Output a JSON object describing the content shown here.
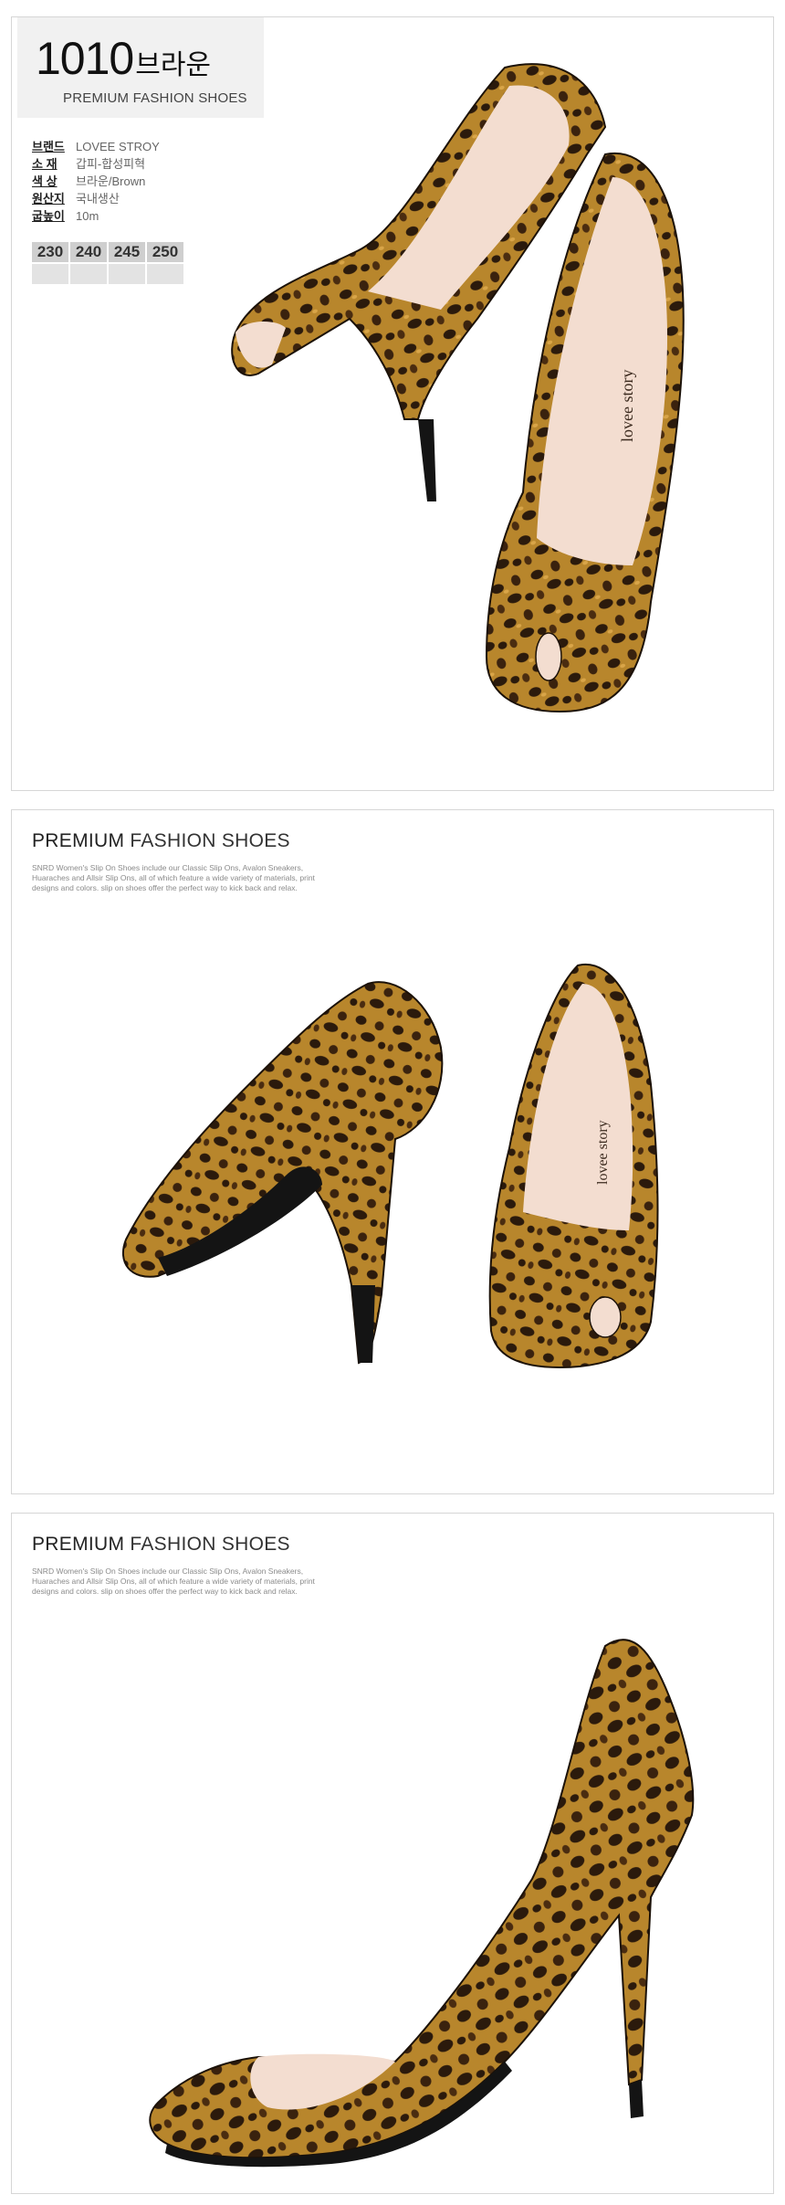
{
  "header": {
    "model_number": "1010",
    "model_color": "브라운",
    "subtitle": "PREMIUM FASHION SHOES"
  },
  "specs": [
    {
      "key": "브랜드",
      "value": "LOVEE STROY"
    },
    {
      "key": "소   재",
      "value": "갑피-합성피혁"
    },
    {
      "key": "색   상",
      "value": "브라운/Brown"
    },
    {
      "key": "원산지",
      "value": "국내생산"
    },
    {
      "key": "굽높이",
      "value": "10m"
    }
  ],
  "sizes": [
    "230",
    "240",
    "245",
    "250"
  ],
  "sections": [
    {
      "title_a": "PREMIUM",
      "title_b": " FASHION SHOES",
      "desc": "SNRD Women's Slip On Shoes include our Classic Slip Ons, Avalon Sneakers, Huaraches and Allsir Slip Ons, all of which feature a wide variety of materials, print designs and colors. slip on shoes offer the perfect way to kick back and relax."
    },
    {
      "title_a": "PREMIUM",
      "title_b": " FASHION SHOES",
      "desc": "SNRD Women's Slip On Shoes include our Classic Slip Ons, Avalon Sneakers, Huaraches and Allsir Slip Ons, all of which feature a wide variety of materials, print designs and colors. slip on shoes offer the perfect way to kick back and relax."
    }
  ],
  "insole_brand": "lovee story",
  "colors": {
    "leopard_base": "#b8862c",
    "leopard_spot": "#2b1a0c",
    "lining": "#f3ddd0",
    "sole": "#141414"
  }
}
